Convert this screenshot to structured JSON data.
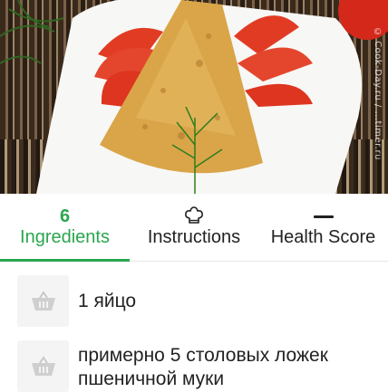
{
  "hero": {
    "watermark": "© Cook-Day.ru / ...timer.ru",
    "image_description": "Fried breaded triangles with tomato slices and dill on a white plate"
  },
  "tabs": [
    {
      "count": "6",
      "label": "Ingredients",
      "active": true,
      "icon": null
    },
    {
      "label": "Instructions",
      "active": false,
      "icon": "chef-hat-icon"
    },
    {
      "label": "Health Score",
      "active": false,
      "icon": "dash-icon"
    }
  ],
  "ingredients": [
    {
      "text": "1 яйцо",
      "icon": "basket-icon"
    },
    {
      "text": "примерно 5 столовых ложек пшеничной муки",
      "icon": "basket-icon"
    }
  ],
  "colors": {
    "accent": "#2aa64f",
    "text": "#222222",
    "thumb_bg": "#f4f4f4"
  }
}
